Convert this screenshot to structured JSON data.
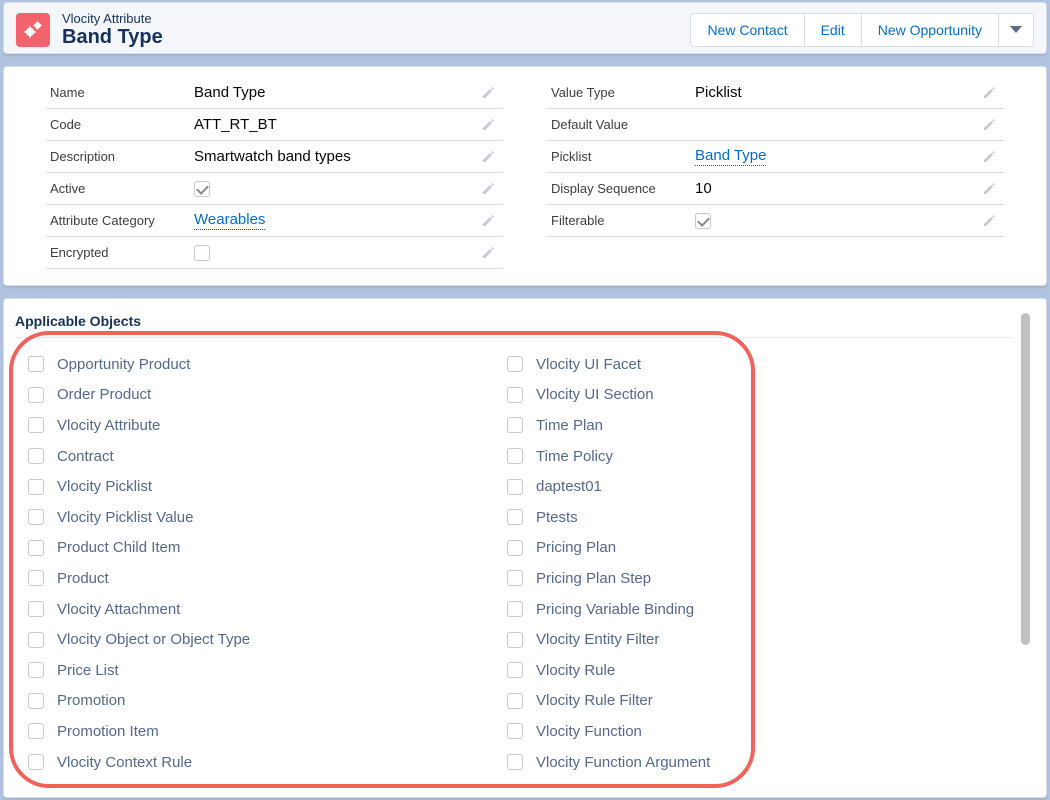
{
  "header": {
    "object_type": "Vlocity Attribute",
    "record_name": "Band Type",
    "icon": "settings-gears-icon",
    "icon_color": "#f2636d",
    "buttons": [
      "New Contact",
      "Edit",
      "New Opportunity"
    ],
    "menu_icon": "chevron-down-icon"
  },
  "details": {
    "left": [
      {
        "label": "Name",
        "value": "Band Type",
        "type": "text"
      },
      {
        "label": "Code",
        "value": "ATT_RT_BT",
        "type": "text"
      },
      {
        "label": "Description",
        "value": "Smartwatch band types",
        "type": "text"
      },
      {
        "label": "Active",
        "value": "",
        "type": "checkbox",
        "checked": true
      },
      {
        "label": "Attribute Category",
        "value": "Wearables",
        "type": "link"
      },
      {
        "label": "Encrypted",
        "value": "",
        "type": "checkbox",
        "checked": false
      }
    ],
    "right": [
      {
        "label": "Value Type",
        "value": "Picklist",
        "type": "text"
      },
      {
        "label": "Default Value",
        "value": "",
        "type": "text"
      },
      {
        "label": "Picklist",
        "value": "Band Type",
        "type": "link"
      },
      {
        "label": "Display Sequence",
        "value": "10",
        "type": "text"
      },
      {
        "label": "Filterable",
        "value": "",
        "type": "checkbox",
        "checked": true
      }
    ]
  },
  "applicable": {
    "title": "Applicable Objects",
    "left": [
      "Opportunity Product",
      "Order Product",
      "Vlocity Attribute",
      "Contract",
      "Vlocity Picklist",
      "Vlocity Picklist Value",
      "Product Child Item",
      "Product",
      "Vlocity Attachment",
      "Vlocity Object or Object Type",
      "Price List",
      "Promotion",
      "Promotion Item",
      "Vlocity Context Rule"
    ],
    "right": [
      "Vlocity UI Facet",
      "Vlocity UI Section",
      "Time Plan",
      "Time Policy",
      "daptest01",
      "Ptests",
      "Pricing Plan",
      "Pricing Plan Step",
      "Pricing Variable Binding",
      "Vlocity Entity Filter",
      "Vlocity Rule",
      "Vlocity Rule Filter",
      "Vlocity Function",
      "Vlocity Function Argument"
    ]
  },
  "colors": {
    "background": "#b0c4df",
    "link": "#006dcc",
    "highlight": "#f0625a"
  }
}
